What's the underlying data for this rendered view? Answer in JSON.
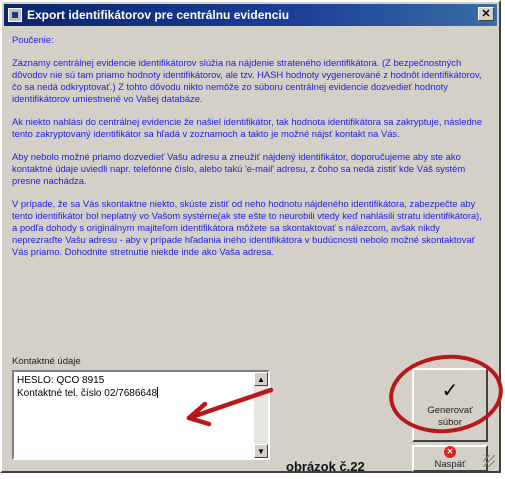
{
  "window": {
    "title": "Export identifikátorov pre centrálnu evidenciu"
  },
  "instructions": {
    "heading": "Poučenie:",
    "paragraphs": [
      "Záznamy centrálnej evidencie identifikátorov slúžia na nájdenie strateného identifikátora. (Z bezpečnostných dôvodov nie sú tam priamo hodnoty identifikátorov, ale tzv. HASH hodnoty vygenerované z hodnôt identifikátorov, čo sa nedá odkryptovať.) Z tohto dôvodu nikto nemôže zo súboru centrálnej evidencie dozvedieť hodnoty identifikátorov umiestnené vo Vašej databáze.",
      "Ak niekto nahlási do centrálnej evidencie že našiel identifikátor, tak hodnota identifikátora sa zakryptuje, následne tento zakryptovaný identifikátor sa hľadá v zoznamoch a takto je možné nájsť kontakt na Vás.",
      "Aby nebolo možné priamo dozvedieť Vašu adresu a zneužiť nájdený identifikátor, doporučujeme aby ste ako kontaktné údaje uviedli napr. telefónne číslo, alebo takú 'e-mail' adresu, z čoho sa nedá zistiť kde Váš systém presne nachádza.",
      "V prípade, že sa Vás skontaktne niekto, skúste zistiť od neho hodnotu nájdeného identifikátora, zabezpečte aby tento identifikátor bol neplatný vo Vašom systéme(ak ste ešte to neurobili vtedy keď nahlásili stratu identifikátora), a podľa dohody s originálnym majiteľom identifikátora môžete sa skontaktovať s nálezcom, avšak nikdy neprezraďte Vašu adresu - aby v prípade hľadania iného identifikátora v budúcnosti nebolo možné skontaktovať Vás priamo. Dohodnite stretnutie niekde inde ako Vaša adresa."
    ]
  },
  "contact": {
    "label": "Kontaktné údaje",
    "line1": "HESLO: QCO 8915",
    "line2": "Kontaktné tel. číslo 02/7686648"
  },
  "buttons": {
    "generate_line1": "Generovať",
    "generate_line2": "súbor",
    "back": "Naspäť"
  },
  "caption": "obrázok č.22",
  "icons": {
    "close": "close-icon",
    "generate": "checkmark-icon",
    "back": "red-x-icon"
  },
  "colors": {
    "instruction_text": "#2020e0",
    "titlebar": "#0a246a",
    "annotation": "#b81818"
  }
}
